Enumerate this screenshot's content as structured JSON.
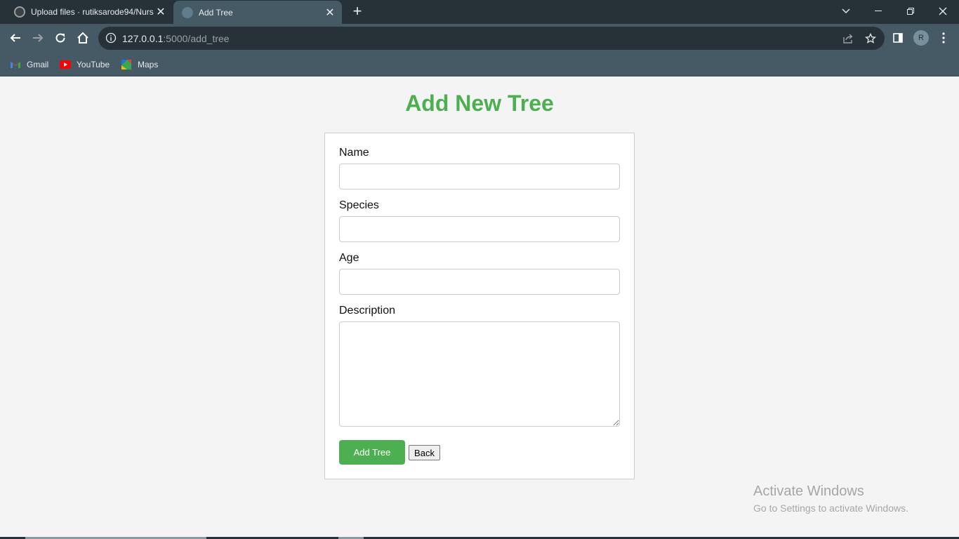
{
  "browser": {
    "tabs": [
      {
        "title": "Upload files · rutiksarode94/Nurs",
        "active": false,
        "favicon": "github-icon"
      },
      {
        "title": "Add Tree",
        "active": true,
        "favicon": "globe-icon"
      }
    ],
    "url": {
      "host": "127.0.0.1",
      "rest": ":5000/add_tree"
    },
    "profile_initial": "R",
    "bookmarks": [
      {
        "label": "Gmail",
        "icon": "gmail-icon"
      },
      {
        "label": "YouTube",
        "icon": "youtube-icon"
      },
      {
        "label": "Maps",
        "icon": "maps-icon"
      }
    ]
  },
  "page": {
    "title": "Add New Tree",
    "fields": [
      {
        "label": "Name",
        "value": ""
      },
      {
        "label": "Species",
        "value": ""
      },
      {
        "label": "Age",
        "value": ""
      },
      {
        "label": "Description",
        "value": ""
      }
    ],
    "submit_label": "Add Tree",
    "back_label": "Back"
  },
  "watermark": {
    "title": "Activate Windows",
    "subtitle": "Go to Settings to activate Windows."
  },
  "colors": {
    "accent": "#4caf50",
    "chrome_dark": "#263238",
    "chrome_toolbar": "#455a64",
    "page_bg": "#f4f4f4"
  }
}
